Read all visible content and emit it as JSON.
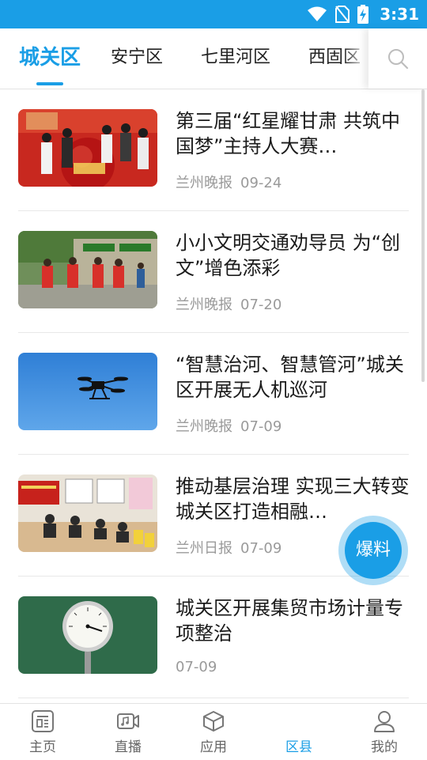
{
  "status_bar": {
    "time": "3:31"
  },
  "tabs": [
    {
      "label": "城关区",
      "active": true
    },
    {
      "label": "安宁区"
    },
    {
      "label": "七里河区"
    },
    {
      "label": "西固区"
    }
  ],
  "search": {
    "icon": "search-icon"
  },
  "articles": [
    {
      "title": "第三届“红星耀甘肃 共筑中国梦”主持人大赛…",
      "source": "兰州晚报",
      "date": "09-24"
    },
    {
      "title": "小小文明交通劝导员 为“创文”增色添彩",
      "source": "兰州晚报",
      "date": "07-20"
    },
    {
      "title": "“智慧治河、智慧管河”城关区开展无人机巡河",
      "source": "兰州晚报",
      "date": "07-09"
    },
    {
      "title": "推动基层治理 实现三大转变 城关区打造相融…",
      "source": "兰州日报",
      "date": "07-09"
    },
    {
      "title": "城关区开展集贸市场计量专项整治",
      "source": "",
      "date": "07-09"
    }
  ],
  "fab": {
    "label": "爆料"
  },
  "bottom_nav": [
    {
      "label": "主页",
      "icon": "home-icon"
    },
    {
      "label": "直播",
      "icon": "live-video-icon"
    },
    {
      "label": "应用",
      "icon": "apps-cube-icon"
    },
    {
      "label": "区县",
      "icon": "district-icon",
      "active": true
    },
    {
      "label": "我的",
      "icon": "profile-icon"
    }
  ],
  "colors": {
    "accent": "#1a9ee6",
    "text": "#1b1b1b",
    "meta": "#9a9a9a"
  }
}
